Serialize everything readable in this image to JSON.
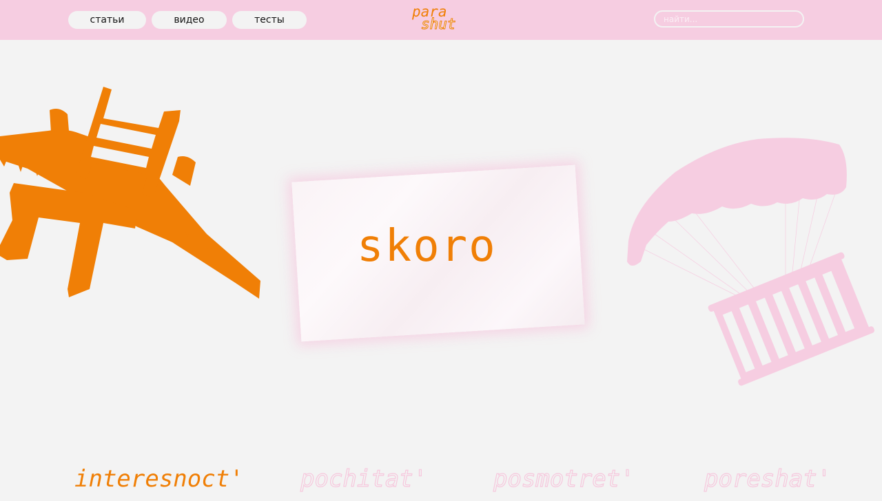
{
  "header": {
    "nav": [
      {
        "label": "статьи"
      },
      {
        "label": "видео"
      },
      {
        "label": "тесты"
      }
    ],
    "logo": {
      "line1": "para",
      "line2": "shut"
    },
    "search": {
      "placeholder": "найти..."
    }
  },
  "main": {
    "headline": "skoro"
  },
  "footer": {
    "words": [
      {
        "label": "interesnoct'",
        "active": true
      },
      {
        "label": "pochitat'",
        "active": false
      },
      {
        "label": "posmotret'",
        "active": false
      },
      {
        "label": "poreshat'",
        "active": false
      }
    ]
  },
  "colors": {
    "accent_orange": "#f07f06",
    "accent_pink": "#f6cde1",
    "background": "#f3f3f3"
  },
  "icons": [
    "plane-chair-illustration",
    "parachute-radiator-illustration",
    "crumpled-paper"
  ]
}
